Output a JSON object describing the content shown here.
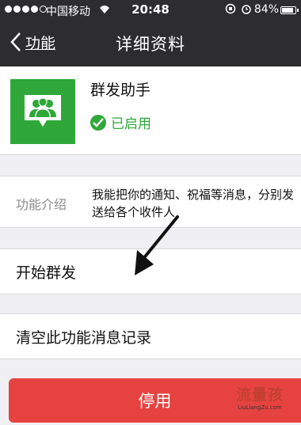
{
  "status_bar": {
    "carrier": "中国移动",
    "time": "20:48",
    "battery": "84%"
  },
  "nav": {
    "back_label": "功能",
    "title": "详细资料"
  },
  "profile": {
    "name": "群发助手",
    "status": "已启用"
  },
  "description": {
    "label": "功能介绍",
    "text": "我能把你的通知、祝福等消息，分别发送给各个收件人"
  },
  "actions": {
    "start": "开始群发",
    "clear": "清空此功能消息记录",
    "disable": "停用"
  },
  "watermark": {
    "title": "流量孩",
    "url": "LiuLiangZu.com"
  },
  "colors": {
    "accent_green": "#2fa839",
    "danger_red": "#e64340",
    "nav_bg": "#2d2d30"
  }
}
